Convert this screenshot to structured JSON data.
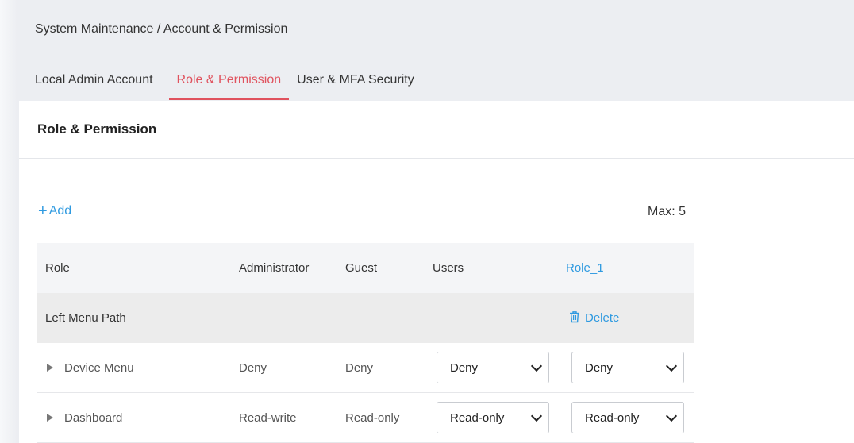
{
  "breadcrumb": "System Maintenance / Account & Permission",
  "tabs": [
    {
      "label": "Local Admin Account"
    },
    {
      "label": "Role & Permission"
    },
    {
      "label": "User & MFA Security"
    }
  ],
  "active_tab": "Role & Permission",
  "panel": {
    "title": "Role & Permission",
    "add_label": "Add",
    "max_label": "Max: 5"
  },
  "table": {
    "headers": {
      "role": "Role",
      "administrator": "Administrator",
      "guest": "Guest",
      "users": "Users",
      "role_1": "Role_1"
    },
    "group_row": {
      "label": "Left Menu Path",
      "delete_label": "Delete"
    },
    "rows": [
      {
        "name": "Device Menu",
        "administrator": "Deny",
        "guest": "Deny",
        "users": "Deny",
        "role_1": "Deny"
      },
      {
        "name": "Dashboard",
        "administrator": "Read-write",
        "guest": "Read-only",
        "users": "Read-only",
        "role_1": "Read-only"
      }
    ]
  },
  "colors": {
    "accent_tab": "#e0525e",
    "link": "#2f9ae0"
  },
  "icons": {
    "add": "plus-icon",
    "delete": "trash-icon",
    "expand": "caret-right-icon",
    "select": "chevron-down-icon"
  }
}
